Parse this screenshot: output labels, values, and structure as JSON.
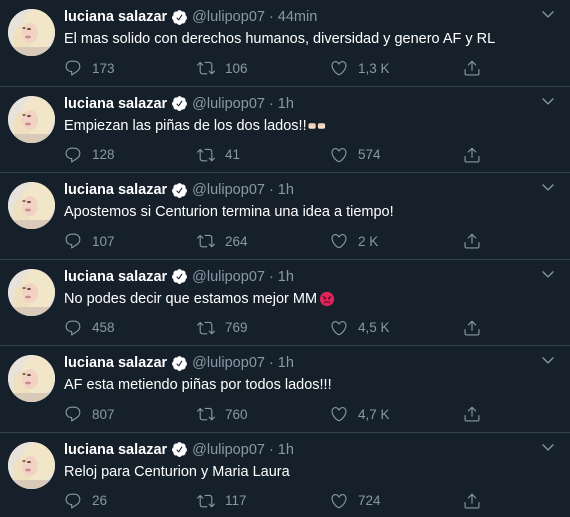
{
  "tweets": [
    {
      "name": "luciana salazar",
      "handle": "@lulipop07",
      "dot": "·",
      "time": "44min",
      "text": "El mas solido con derechos humanos, diversidad y genero AF y RL",
      "emoji": "",
      "replies": "173",
      "retweets": "106",
      "likes": "1,3 K"
    },
    {
      "name": "luciana salazar",
      "handle": "@lulipop07",
      "dot": "·",
      "time": "1h",
      "text": "Empiezan las piñas de los dos lados!!",
      "emoji": "fist-emoji",
      "replies": "128",
      "retweets": "41",
      "likes": "574"
    },
    {
      "name": "luciana salazar",
      "handle": "@lulipop07",
      "dot": "·",
      "time": "1h",
      "text": "Apostemos si Centurion termina una idea a tiempo!",
      "emoji": "",
      "replies": "107",
      "retweets": "264",
      "likes": "2 K"
    },
    {
      "name": "luciana salazar",
      "handle": "@lulipop07",
      "dot": "·",
      "time": "1h",
      "text": "No podes decir que estamos mejor MM",
      "emoji": "angry-emoji",
      "replies": "458",
      "retweets": "769",
      "likes": "4,5 K"
    },
    {
      "name": "luciana salazar",
      "handle": "@lulipop07",
      "dot": "·",
      "time": "1h",
      "text": "AF esta metiendo piñas por todos lados!!!",
      "emoji": "",
      "replies": "807",
      "retweets": "760",
      "likes": "4,7 K"
    },
    {
      "name": "luciana salazar",
      "handle": "@lulipop07",
      "dot": "·",
      "time": "1h",
      "text": "Reloj para Centurion y Maria Laura",
      "emoji": "",
      "replies": "26",
      "retweets": "117",
      "likes": "724"
    }
  ],
  "icons": {
    "reply": "reply-icon",
    "retweet": "retweet-icon",
    "like": "heart-icon",
    "share": "share-icon",
    "verified": "verified-badge-icon",
    "menu": "chevron-down-icon"
  },
  "colors": {
    "background": "#15202b",
    "muted": "#8899a6",
    "verified": "#ffffff",
    "divider": "#38444d"
  }
}
